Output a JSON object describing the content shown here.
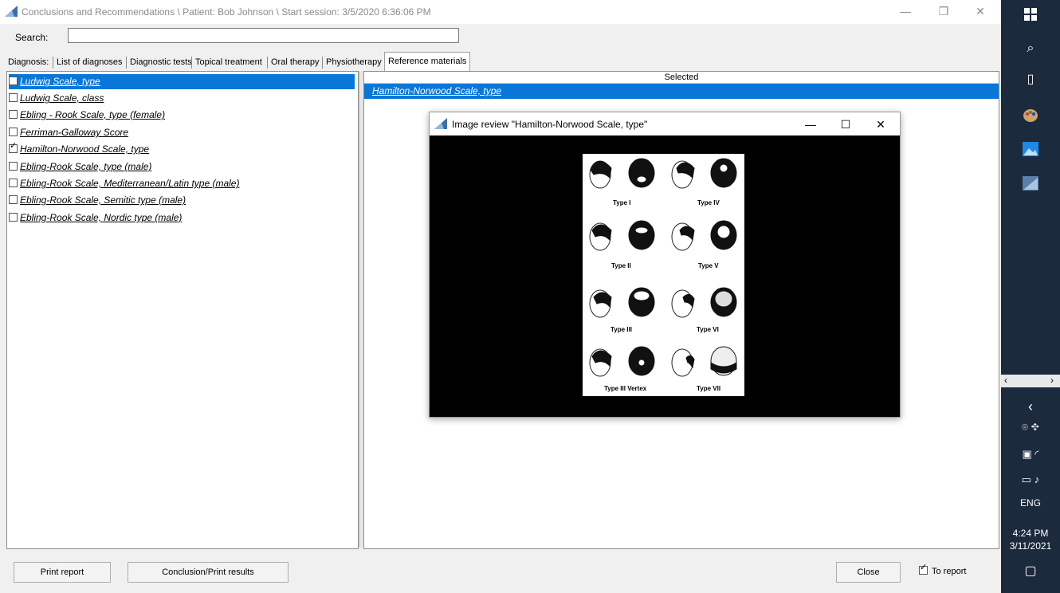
{
  "window": {
    "title": "Conclusions and Recommendations \\ Patient: Bob Johnson \\ Start session: 3/5/2020 6:36:06 PM",
    "minimize": "—",
    "restore": "❐",
    "close": "✕"
  },
  "search": {
    "label": "Search:",
    "value": "",
    "placeholder": ""
  },
  "tabs": [
    {
      "label": "Diagnosis:"
    },
    {
      "label": "List of diagnoses"
    },
    {
      "label": "Diagnostic tests"
    },
    {
      "label": "Topical treatment"
    },
    {
      "label": "Oral therapy"
    },
    {
      "label": "Physiotherapy"
    },
    {
      "label": "Reference materials"
    }
  ],
  "list": [
    {
      "label": "Ludwig Scale, type",
      "checked": false,
      "selected": true
    },
    {
      "label": "Ludwig Scale, class",
      "checked": false
    },
    {
      "label": "Ebling - Rook Scale, type (female)",
      "checked": false
    },
    {
      "label": "Ferriman-Galloway Score",
      "checked": false
    },
    {
      "label": "Hamilton-Norwood Scale, type",
      "checked": true
    },
    {
      "label": "Ebling-Rook Scale, type (male)",
      "checked": false
    },
    {
      "label": "Ebling-Rook Scale, Mediterranean/Latin type (male)",
      "checked": false
    },
    {
      "label": "Ebling-Rook Scale, Semitic type (male)",
      "checked": false
    },
    {
      "label": "Ebling-Rook Scale, Nordic type (male)",
      "checked": false
    }
  ],
  "selected_panel": {
    "header": "Selected",
    "items": [
      "Hamilton-Norwood Scale, type"
    ]
  },
  "modal": {
    "title": "Image review \"Hamilton-Norwood Scale, type\"",
    "minimize": "—",
    "maximize": "☐",
    "close": "✕",
    "image_labels": [
      "Type I",
      "Type IV",
      "Type II",
      "Type V",
      "Type III",
      "Type VI",
      "Type III Vertex",
      "Type VII"
    ]
  },
  "buttons": {
    "print_report": "Print report",
    "conclusion": "Conclusion/Print results",
    "close": "Close",
    "to_report": "To report"
  },
  "taskbar": {
    "lang": "ENG",
    "time": "4:24 PM",
    "date": "3/11/2021"
  },
  "colors": {
    "selection": "#0a77d8",
    "taskbar": "#1b2a3d"
  }
}
